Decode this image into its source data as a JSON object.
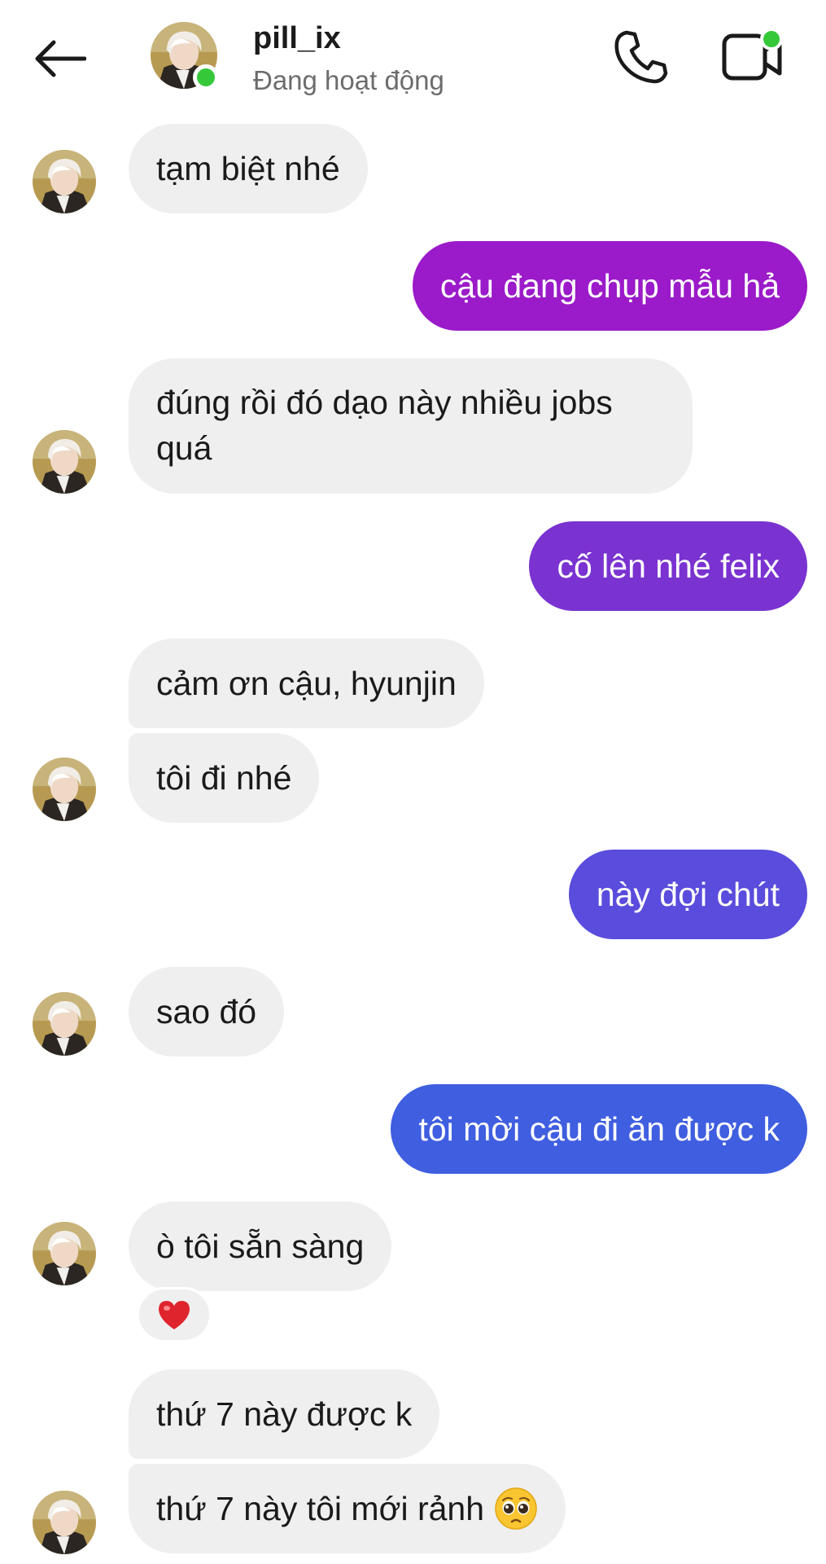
{
  "header": {
    "username": "pill_ix",
    "status": "Đang hoạt động"
  },
  "messages": [
    {
      "text": "tạm biệt nhé",
      "from": "them"
    },
    {
      "text": "cậu đang chụp mẫu hả",
      "from": "me"
    },
    {
      "line1": "đúng rồi đó dạo này nhiều jobs",
      "line2": "quá",
      "from": "them"
    },
    {
      "text": "cố lên nhé felix",
      "from": "me"
    },
    {
      "text": "cảm ơn cậu, hyunjin",
      "from": "them"
    },
    {
      "text": "tôi đi nhé",
      "from": "them"
    },
    {
      "text": "này đợi chút",
      "from": "me"
    },
    {
      "text": "sao đó",
      "from": "them"
    },
    {
      "text": "tôi mời cậu đi ăn được k",
      "from": "me"
    },
    {
      "text": "ò tôi sẵn sàng",
      "from": "them"
    },
    {
      "text": "thứ 7 này được k",
      "from": "them"
    },
    {
      "text": "thứ 7 này tôi mới rảnh",
      "from": "them"
    }
  ],
  "reaction": {
    "emoji": "❤️"
  },
  "colors": {
    "incoming_bubble": "#efefef",
    "outgoing_gradient": [
      "#9b1ac9",
      "#7a32d1",
      "#5a4cdc",
      "#3f5ee0"
    ],
    "online": "#35c93a"
  },
  "icons": [
    "back-arrow-icon",
    "phone-icon",
    "video-camera-icon",
    "pleading-face-emoji-icon"
  ]
}
